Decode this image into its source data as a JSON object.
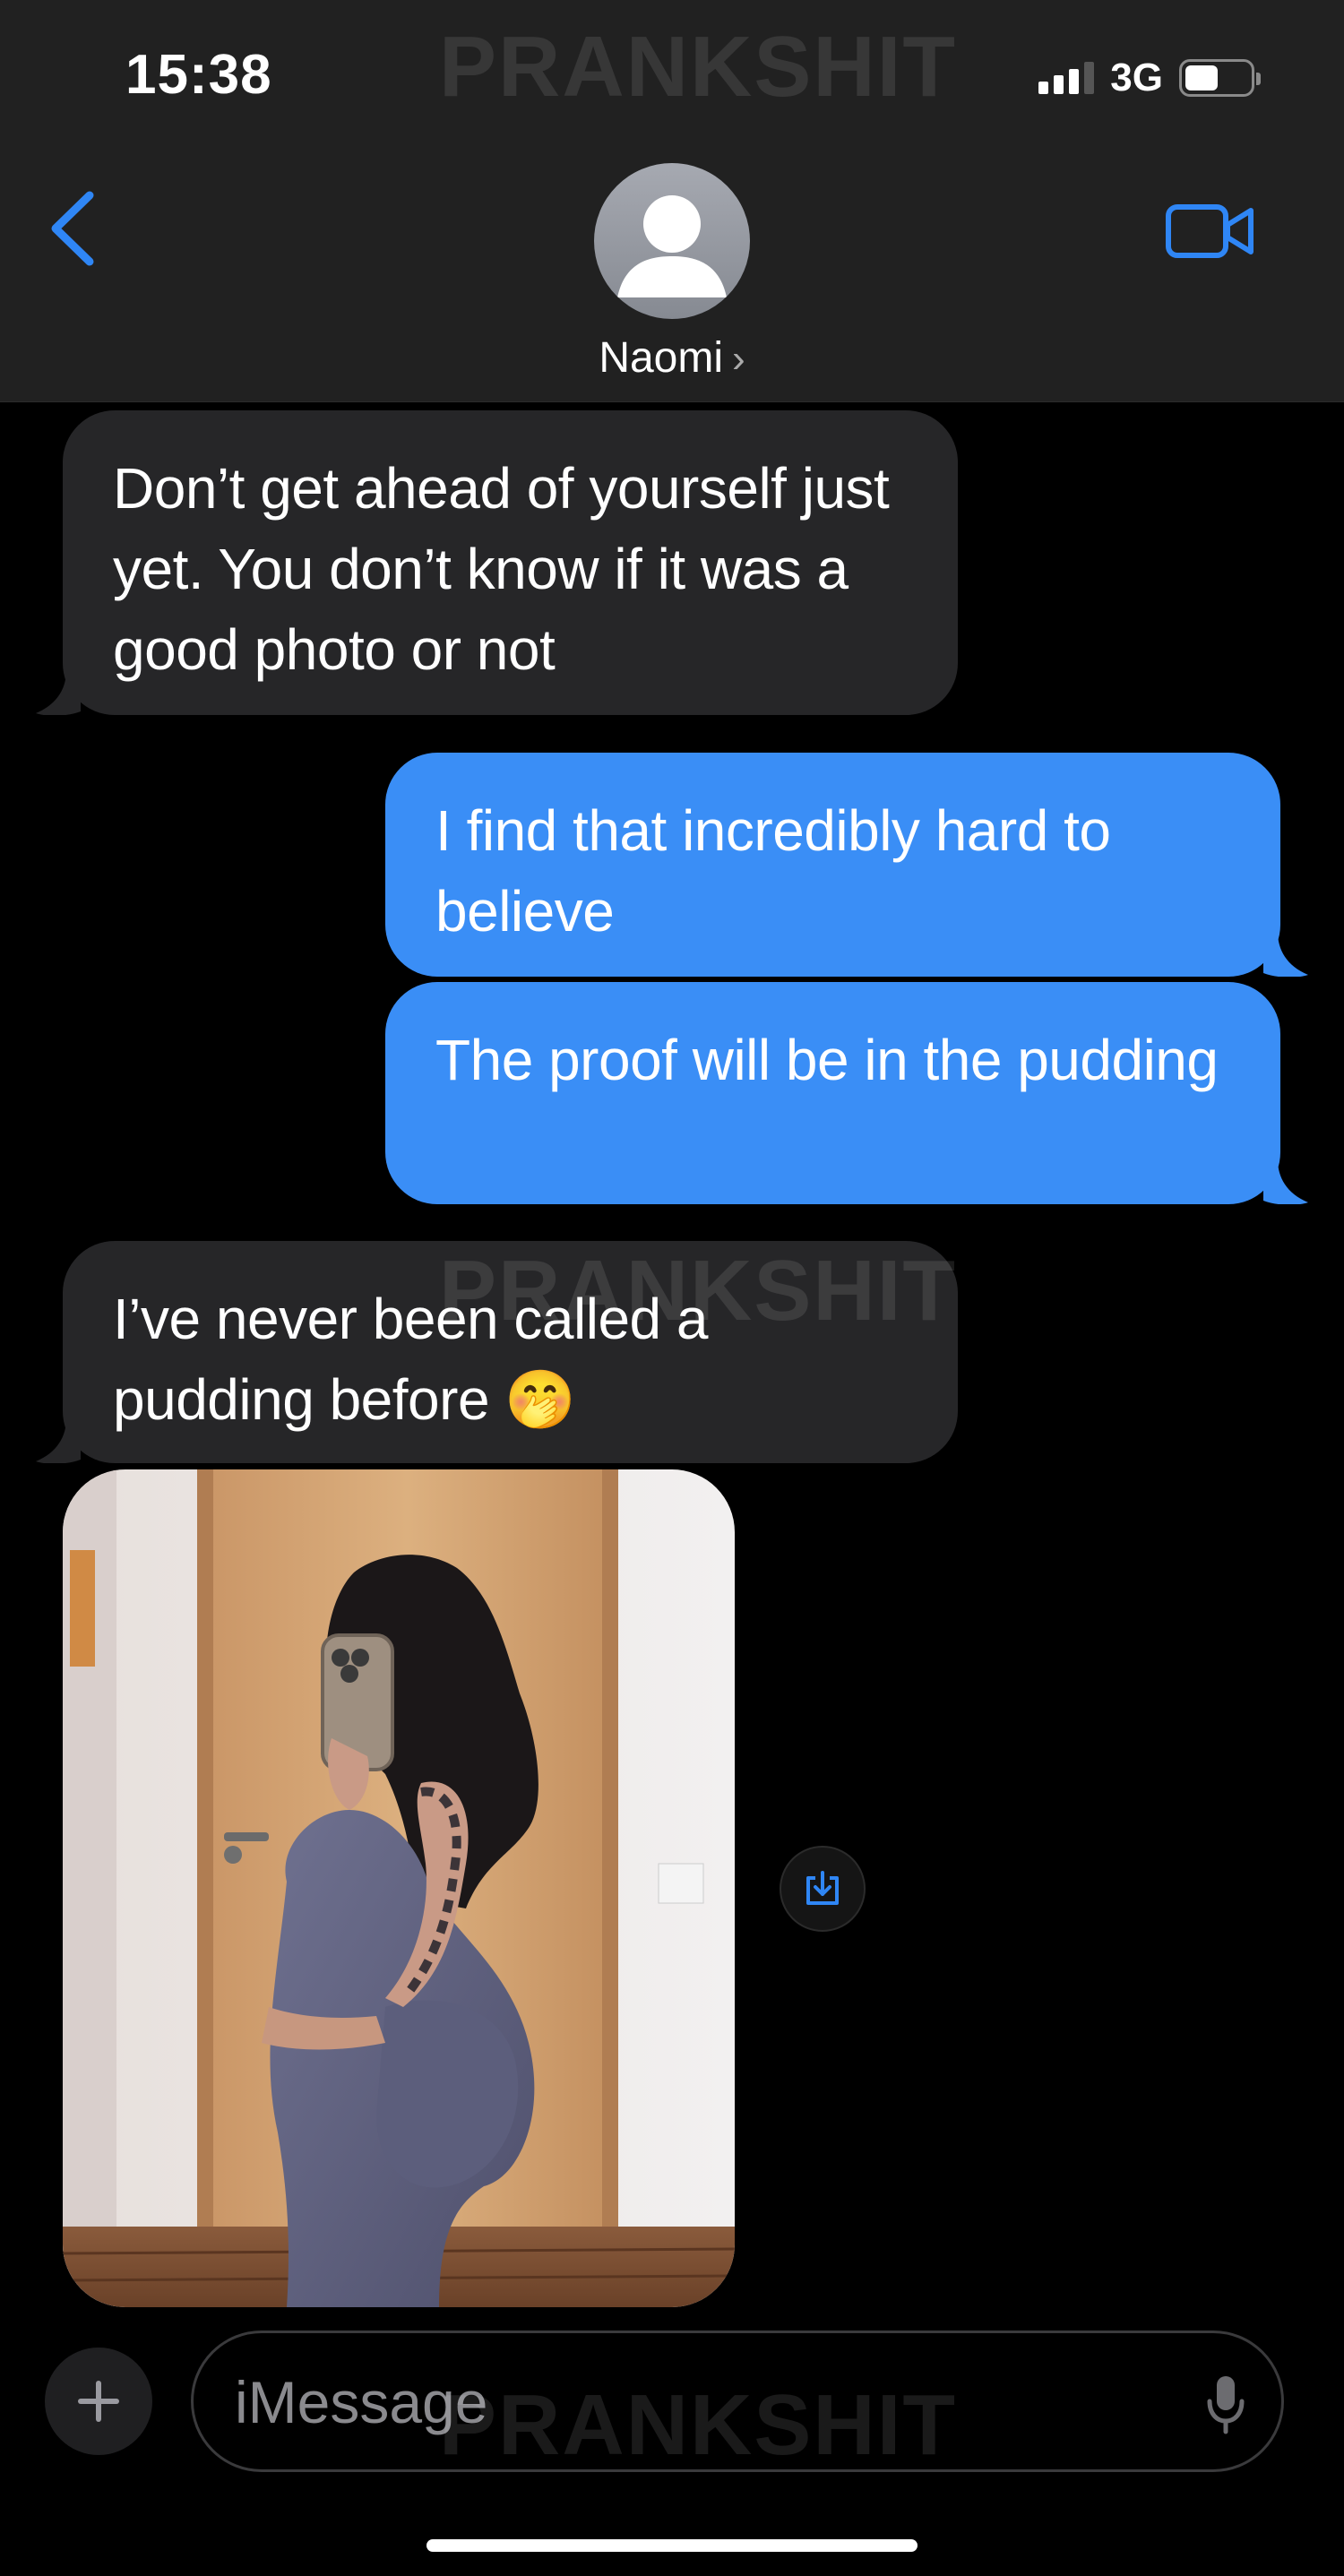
{
  "status_bar": {
    "time": "15:38",
    "network": "3G"
  },
  "watermark": "PRANKSHIT",
  "header": {
    "contact_name": "Naomi",
    "chevron": "›",
    "back_icon": "chevron-left-icon",
    "video_icon": "video-camera-icon",
    "accent_color": "#3a8ef6"
  },
  "messages": [
    {
      "direction": "incoming",
      "text": "Don’t get ahead of yourself just yet. You don’t know if it was a good photo or not"
    },
    {
      "direction": "outgoing",
      "text": "I find that incredibly hard to believe"
    },
    {
      "direction": "outgoing",
      "text": "The proof will be in the pudding"
    },
    {
      "direction": "incoming",
      "text": "I’ve never been called a pudding before 🤭"
    },
    {
      "direction": "incoming",
      "type": "photo"
    }
  ],
  "composer": {
    "placeholder": "iMessage",
    "plus_icon": "plus-icon",
    "mic_icon": "microphone-icon",
    "save_icon": "save-download-icon"
  },
  "colors": {
    "incoming_bubble": "#262628",
    "outgoing_bubble": "#3a8ef6",
    "header_bg": "#212121"
  }
}
